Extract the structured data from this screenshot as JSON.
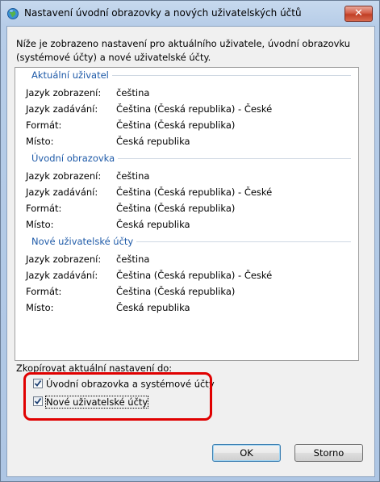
{
  "window": {
    "title": "Nastavení úvodní obrazovky a nových uživatelských účtů",
    "close_glyph": "✕"
  },
  "intro": "Níže je zobrazeno nastavení pro aktuálního uživatele, úvodní obrazovku (systémové účty) a nové uživatelské účty.",
  "sections": [
    {
      "title": "Aktuální uživatel",
      "rows": [
        {
          "label": "Jazyk zobrazení:",
          "value": "čeština"
        },
        {
          "label": "Jazyk zadávání:",
          "value": "Čeština (Česká republika) - České"
        },
        {
          "label": "Formát:",
          "value": "Čeština (Česká republika)"
        },
        {
          "label": "Místo:",
          "value": "Česká republika"
        }
      ]
    },
    {
      "title": "Úvodní obrazovka",
      "rows": [
        {
          "label": "Jazyk zobrazení:",
          "value": "čeština"
        },
        {
          "label": "Jazyk zadávání:",
          "value": "Čeština (Česká republika) - České"
        },
        {
          "label": "Formát:",
          "value": "Čeština (Česká republika)"
        },
        {
          "label": "Místo:",
          "value": "Česká republika"
        }
      ]
    },
    {
      "title": "Nové uživatelské účty",
      "rows": [
        {
          "label": "Jazyk zobrazení:",
          "value": "čeština"
        },
        {
          "label": "Jazyk zadávání:",
          "value": "Čeština (Česká republika) - České"
        },
        {
          "label": "Formát:",
          "value": "Čeština (Česká republika)"
        },
        {
          "label": "Místo:",
          "value": "Česká republika"
        }
      ]
    }
  ],
  "copy": {
    "label": "Zkopírovat aktuální nastavení do:",
    "options": [
      {
        "label": "Úvodní obrazovka a systémové účty",
        "checked": true
      },
      {
        "label": "Nové uživatelské účty",
        "checked": true
      }
    ]
  },
  "buttons": {
    "ok": "OK",
    "cancel": "Storno"
  },
  "colors": {
    "section_title": "#1e5aa8",
    "highlight": "#e00000"
  },
  "icons": {
    "title": "globe-icon",
    "close": "close-icon",
    "check": "checkmark-icon"
  }
}
